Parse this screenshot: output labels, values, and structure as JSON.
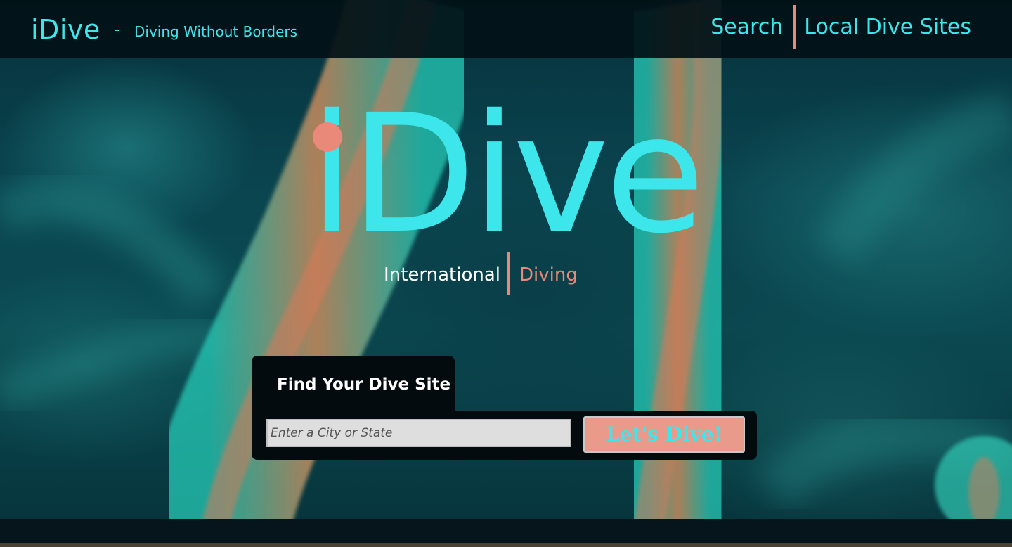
{
  "header": {
    "brand": "iDive",
    "dash": "-",
    "tagline": "Diving Without Borders",
    "nav": [
      {
        "label": "Search"
      },
      {
        "label": "Local Dive Sites"
      }
    ]
  },
  "hero": {
    "logo_text": "iDive",
    "subtitle_left": "International",
    "subtitle_right": "Diving"
  },
  "search": {
    "tab_label": "Find Your Dive Site",
    "input_placeholder": "Enter a City or State",
    "input_value": "",
    "button_label": "Let's Dive!"
  },
  "colors": {
    "accent_cyan": "#3de6ea",
    "accent_coral": "#e8897a",
    "panel_dark": "#040b0e"
  }
}
